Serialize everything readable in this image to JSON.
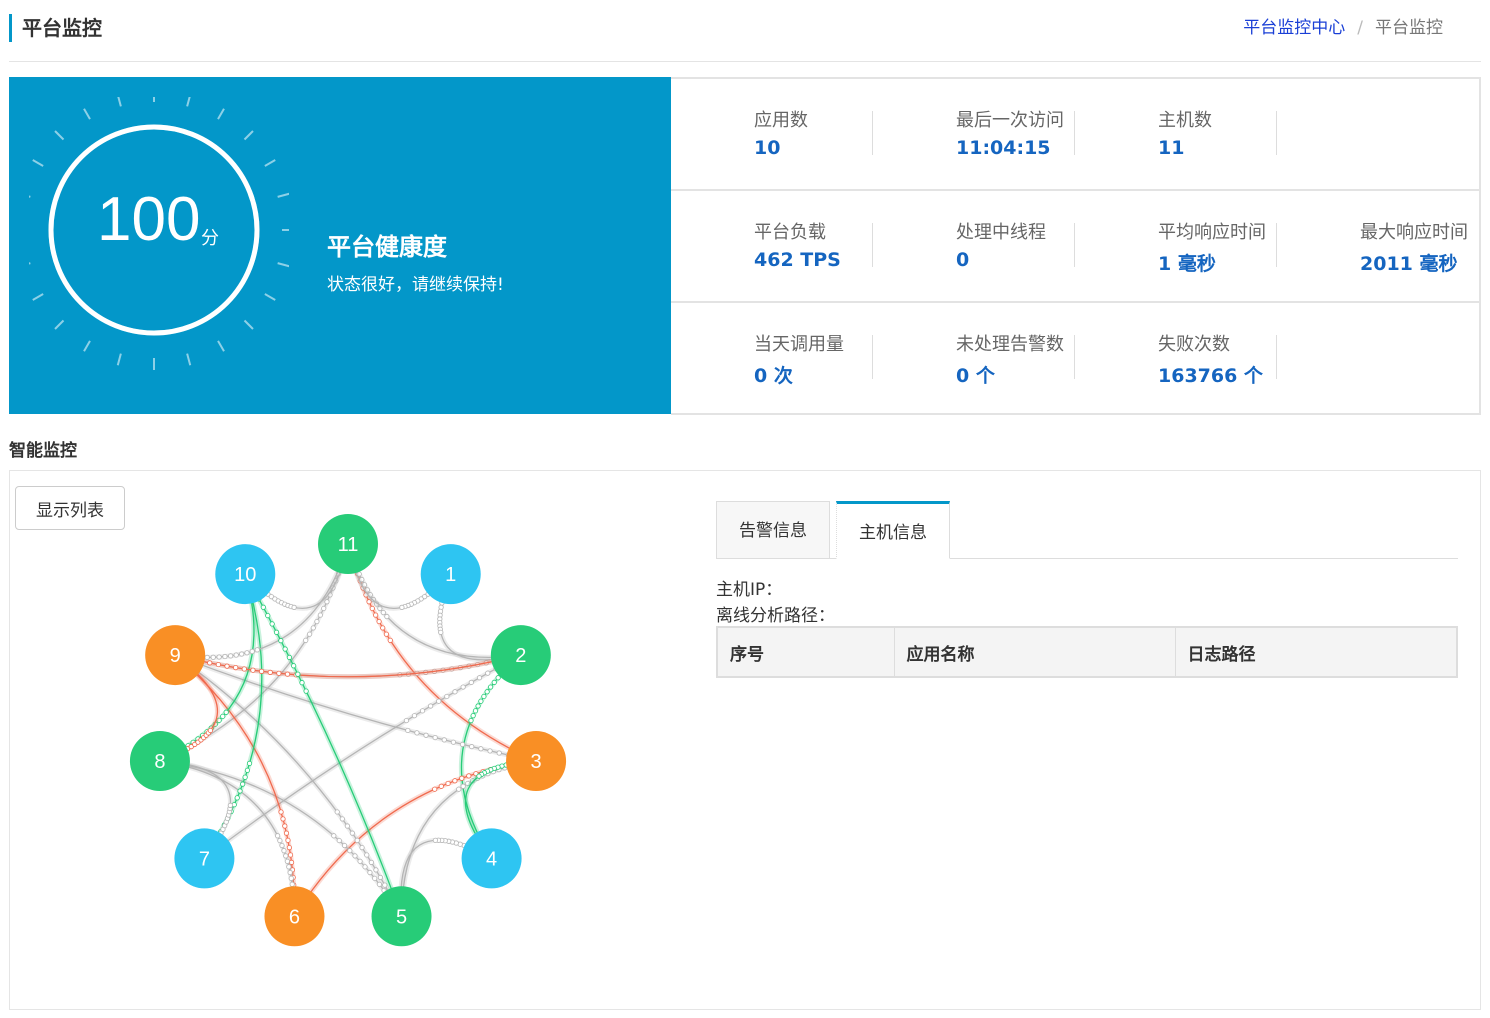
{
  "header": {
    "title": "平台监控",
    "breadcrumb": {
      "parent": "平台监控中心",
      "separator": "/",
      "current": "平台监控"
    }
  },
  "health": {
    "score": "100",
    "score_unit": "分",
    "score_fraction": 1.0,
    "title": "平台健康度",
    "description": "状态很好，请继续保持!"
  },
  "stats": {
    "row1": [
      {
        "label": "应用数",
        "value": "10"
      },
      {
        "label": "最后一次访问",
        "value": "11:04:15"
      },
      {
        "label": "主机数",
        "value": "11"
      }
    ],
    "row2": [
      {
        "label": "平台负载",
        "value": "462 TPS"
      },
      {
        "label": "处理中线程",
        "value": "0"
      },
      {
        "label": "平均响应时间",
        "value": "1 毫秒"
      },
      {
        "label": "最大响应时间",
        "value": "2011 毫秒"
      }
    ],
    "row3": [
      {
        "label": "当天调用量",
        "value": "0 次"
      },
      {
        "label": "未处理告警数",
        "value": "0 个"
      },
      {
        "label": "失败次数",
        "value": "163766 个"
      }
    ]
  },
  "monitor": {
    "section_title": "智能监控",
    "toggle_label": "显示列表",
    "tabs": [
      {
        "label": "告警信息"
      },
      {
        "label": "主机信息"
      }
    ],
    "host_ip_label": "主机IP：",
    "log_path_label": "离线分析路径：",
    "table_headers": [
      "序号",
      "应用名称",
      "日志路径"
    ]
  },
  "graph": {
    "colors": {
      "blue": "#2ec5f2",
      "green": "#27cc78",
      "orange": "#f98f25",
      "gray": "#b5b5b5",
      "red": "#f06a4e"
    },
    "nodes": [
      {
        "label": "11",
        "color": "green"
      },
      {
        "label": "1",
        "color": "blue"
      },
      {
        "label": "2",
        "color": "green"
      },
      {
        "label": "3",
        "color": "orange"
      },
      {
        "label": "4",
        "color": "blue"
      },
      {
        "label": "5",
        "color": "green"
      },
      {
        "label": "6",
        "color": "orange"
      },
      {
        "label": "7",
        "color": "blue"
      },
      {
        "label": "8",
        "color": "green"
      },
      {
        "label": "9",
        "color": "orange"
      },
      {
        "label": "10",
        "color": "blue"
      }
    ],
    "links": [
      [
        "11",
        "3",
        "red"
      ],
      [
        "11",
        "2",
        "gray"
      ],
      [
        "11",
        "8",
        "gray"
      ],
      [
        "1",
        "11",
        "gray"
      ],
      [
        "1",
        "2",
        "gray"
      ],
      [
        "2",
        "4",
        "green"
      ],
      [
        "2",
        "7",
        "gray"
      ],
      [
        "2",
        "9",
        "gray"
      ],
      [
        "3",
        "6",
        "red"
      ],
      [
        "3",
        "5",
        "gray"
      ],
      [
        "3",
        "4",
        "green"
      ],
      [
        "3",
        "9",
        "gray"
      ],
      [
        "4",
        "5",
        "gray"
      ],
      [
        "5",
        "8",
        "gray"
      ],
      [
        "5",
        "9",
        "gray"
      ],
      [
        "6",
        "9",
        "red"
      ],
      [
        "6",
        "8",
        "gray"
      ],
      [
        "7",
        "10",
        "green"
      ],
      [
        "7",
        "8",
        "gray"
      ],
      [
        "8",
        "10",
        "green"
      ],
      [
        "8",
        "9",
        "red"
      ],
      [
        "9",
        "2",
        "red"
      ],
      [
        "9",
        "11",
        "gray"
      ],
      [
        "10",
        "5",
        "green"
      ],
      [
        "10",
        "11",
        "gray"
      ]
    ]
  }
}
